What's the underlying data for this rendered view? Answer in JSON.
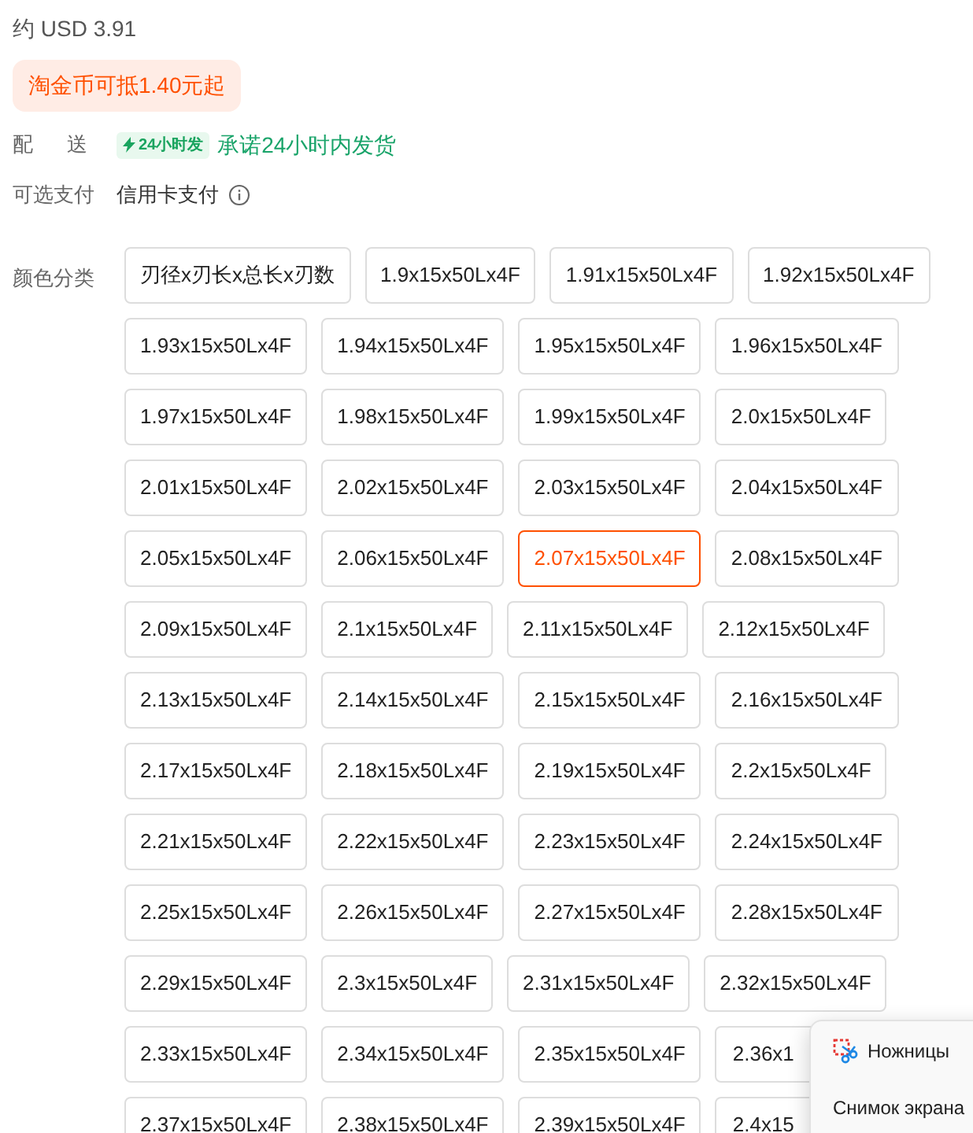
{
  "price": "约 USD 3.91",
  "coin_badge": "淘金币可抵1.40元起",
  "delivery": {
    "label": "配 送",
    "tag": "24小时发",
    "promise": "承诺24小时内发货"
  },
  "payment": {
    "label": "可选支付",
    "method": "信用卡支付"
  },
  "color_options": {
    "label": "颜色分类",
    "options": [
      {
        "text": "刃径x刃长x总长x刃数",
        "selected": false
      },
      {
        "text": "1.9x15x50Lx4F",
        "selected": false
      },
      {
        "text": "1.91x15x50Lx4F",
        "selected": false
      },
      {
        "text": "1.92x15x50Lx4F",
        "selected": false
      },
      {
        "text": "1.93x15x50Lx4F",
        "selected": false
      },
      {
        "text": "1.94x15x50Lx4F",
        "selected": false
      },
      {
        "text": "1.95x15x50Lx4F",
        "selected": false
      },
      {
        "text": "1.96x15x50Lx4F",
        "selected": false
      },
      {
        "text": "1.97x15x50Lx4F",
        "selected": false
      },
      {
        "text": "1.98x15x50Lx4F",
        "selected": false
      },
      {
        "text": "1.99x15x50Lx4F",
        "selected": false
      },
      {
        "text": "2.0x15x50Lx4F",
        "selected": false
      },
      {
        "text": "2.01x15x50Lx4F",
        "selected": false
      },
      {
        "text": "2.02x15x50Lx4F",
        "selected": false
      },
      {
        "text": "2.03x15x50Lx4F",
        "selected": false
      },
      {
        "text": "2.04x15x50Lx4F",
        "selected": false
      },
      {
        "text": "2.05x15x50Lx4F",
        "selected": false
      },
      {
        "text": "2.06x15x50Lx4F",
        "selected": false
      },
      {
        "text": "2.07x15x50Lx4F",
        "selected": true
      },
      {
        "text": "2.08x15x50Lx4F",
        "selected": false
      },
      {
        "text": "2.09x15x50Lx4F",
        "selected": false
      },
      {
        "text": "2.1x15x50Lx4F",
        "selected": false
      },
      {
        "text": "2.11x15x50Lx4F",
        "selected": false
      },
      {
        "text": "2.12x15x50Lx4F",
        "selected": false
      },
      {
        "text": "2.13x15x50Lx4F",
        "selected": false
      },
      {
        "text": "2.14x15x50Lx4F",
        "selected": false
      },
      {
        "text": "2.15x15x50Lx4F",
        "selected": false
      },
      {
        "text": "2.16x15x50Lx4F",
        "selected": false
      },
      {
        "text": "2.17x15x50Lx4F",
        "selected": false
      },
      {
        "text": "2.18x15x50Lx4F",
        "selected": false
      },
      {
        "text": "2.19x15x50Lx4F",
        "selected": false
      },
      {
        "text": "2.2x15x50Lx4F",
        "selected": false
      },
      {
        "text": "2.21x15x50Lx4F",
        "selected": false
      },
      {
        "text": "2.22x15x50Lx4F",
        "selected": false
      },
      {
        "text": "2.23x15x50Lx4F",
        "selected": false
      },
      {
        "text": "2.24x15x50Lx4F",
        "selected": false
      },
      {
        "text": "2.25x15x50Lx4F",
        "selected": false
      },
      {
        "text": "2.26x15x50Lx4F",
        "selected": false
      },
      {
        "text": "2.27x15x50Lx4F",
        "selected": false
      },
      {
        "text": "2.28x15x50Lx4F",
        "selected": false
      },
      {
        "text": "2.29x15x50Lx4F",
        "selected": false
      },
      {
        "text": "2.3x15x50Lx4F",
        "selected": false
      },
      {
        "text": "2.31x15x50Lx4F",
        "selected": false
      },
      {
        "text": "2.32x15x50Lx4F",
        "selected": false
      },
      {
        "text": "2.33x15x50Lx4F",
        "selected": false
      },
      {
        "text": "2.34x15x50Lx4F",
        "selected": false
      },
      {
        "text": "2.35x15x50Lx4F",
        "selected": false
      },
      {
        "text": "2.36x1",
        "selected": false,
        "covered": true
      },
      {
        "text": "2.37x15x50Lx4F",
        "selected": false
      },
      {
        "text": "2.38x15x50Lx4F",
        "selected": false
      },
      {
        "text": "2.39x15x50Lx4F",
        "selected": false
      },
      {
        "text": "2.4x15",
        "selected": false,
        "covered": true
      }
    ]
  },
  "context_menu": {
    "items": [
      {
        "text": "Ножницы",
        "kind": "icon"
      },
      {
        "text": "Снимок экрана",
        "kind": "plain"
      }
    ]
  }
}
